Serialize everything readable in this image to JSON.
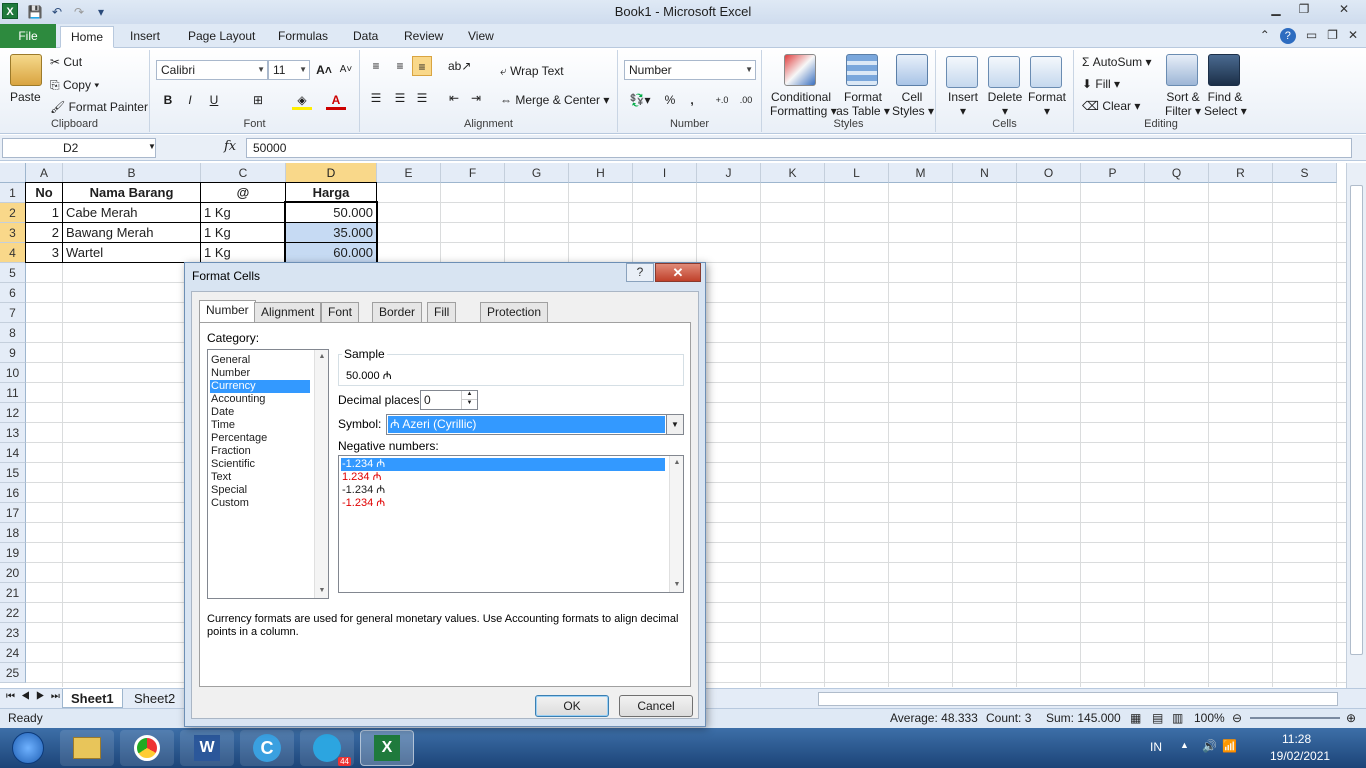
{
  "window": {
    "title": "Book1  -  Microsoft Excel",
    "logo_letter": "X"
  },
  "qat": {
    "save": "💾",
    "undo": "↶",
    "redo": "↷",
    "customize": "▾"
  },
  "ribbon_tabs": [
    "File",
    "Home",
    "Insert",
    "Page Layout",
    "Formulas",
    "Data",
    "Review",
    "View"
  ],
  "ribbon": {
    "clipboard": {
      "paste": "Paste",
      "cut": "Cut",
      "copy": "Copy",
      "format_painter": "Format Painter",
      "label": "Clipboard"
    },
    "font": {
      "name": "Calibri",
      "size": "11",
      "bold": "B",
      "italic": "I",
      "underline": "U",
      "label": "Font"
    },
    "alignment": {
      "wrap": "Wrap Text",
      "merge": "Merge & Center",
      "label": "Alignment"
    },
    "number": {
      "format": "Number",
      "percent": "%",
      "comma": ",",
      "inc": "+.0",
      "dec": ".00",
      "label": "Number"
    },
    "styles": {
      "conditional": "Conditional",
      "conditional2": "Formatting",
      "table": "Format",
      "table2": "as Table",
      "cell": "Cell",
      "cell2": "Styles",
      "label": "Styles"
    },
    "cells": {
      "insert": "Insert",
      "delete": "Delete",
      "format": "Format",
      "label": "Cells"
    },
    "editing": {
      "autosum": "AutoSum",
      "fill": "Fill",
      "clear": "Clear",
      "sort": "Sort &",
      "sort2": "Filter",
      "find": "Find &",
      "find2": "Select",
      "label": "Editing"
    }
  },
  "formula_bar": {
    "name_box": "D2",
    "fx": "fx",
    "value": "50000"
  },
  "columns": [
    "A",
    "B",
    "C",
    "D",
    "E",
    "F",
    "G",
    "H",
    "I",
    "J",
    "K",
    "L",
    "M",
    "N",
    "O",
    "P",
    "Q",
    "R",
    "S"
  ],
  "rows": [
    "1",
    "2",
    "3",
    "4",
    "5",
    "6",
    "7",
    "8",
    "9",
    "10",
    "11",
    "12",
    "13",
    "14",
    "15",
    "16",
    "17",
    "18",
    "19",
    "20",
    "21",
    "22",
    "23",
    "24",
    "25"
  ],
  "sheet": {
    "headers": [
      "No",
      "Nama Barang",
      "@",
      "Harga"
    ],
    "data": [
      [
        "1",
        "Cabe Merah",
        "1 Kg",
        "50.000"
      ],
      [
        "2",
        "Bawang Merah",
        "1 Kg",
        "35.000"
      ],
      [
        "3",
        "Wartel",
        "1 Kg",
        "60.000"
      ]
    ]
  },
  "sheet_tabs": [
    "Sheet1",
    "Sheet2"
  ],
  "status": {
    "mode": "Ready",
    "average": "Average: 48.333",
    "count": "Count: 3",
    "sum": "Sum: 145.000",
    "zoom": "100%"
  },
  "taskbar": {
    "lang": "IN",
    "time": "11:28",
    "date": "19/02/2021",
    "badge": "44"
  },
  "dialog": {
    "title": "Format Cells",
    "help": "?",
    "close": "✕",
    "tabs": [
      "Number",
      "Alignment",
      "Font",
      "Border",
      "Fill",
      "Protection"
    ],
    "category_label": "Category:",
    "categories": [
      "General",
      "Number",
      "Currency",
      "Accounting",
      "Date",
      "Time",
      "Percentage",
      "Fraction",
      "Scientific",
      "Text",
      "Special",
      "Custom"
    ],
    "selected_category": "Currency",
    "sample_label": "Sample",
    "sample_value": "50.000 ₼",
    "decimal_label": "Decimal places:",
    "decimal_value": "0",
    "symbol_label": "Symbol:",
    "symbol_value": "₼ Azeri (Cyrillic)",
    "negative_label": "Negative numbers:",
    "negatives": [
      "-1.234 ₼",
      "1.234 ₼",
      "-1.234 ₼",
      "-1.234 ₼"
    ],
    "description": "Currency formats are used for general monetary values.  Use Accounting formats to align decimal points in a column.",
    "ok": "OK",
    "cancel": "Cancel",
    "colors": {
      "negative_red": "#e00000",
      "selection": "#3399ff"
    }
  }
}
